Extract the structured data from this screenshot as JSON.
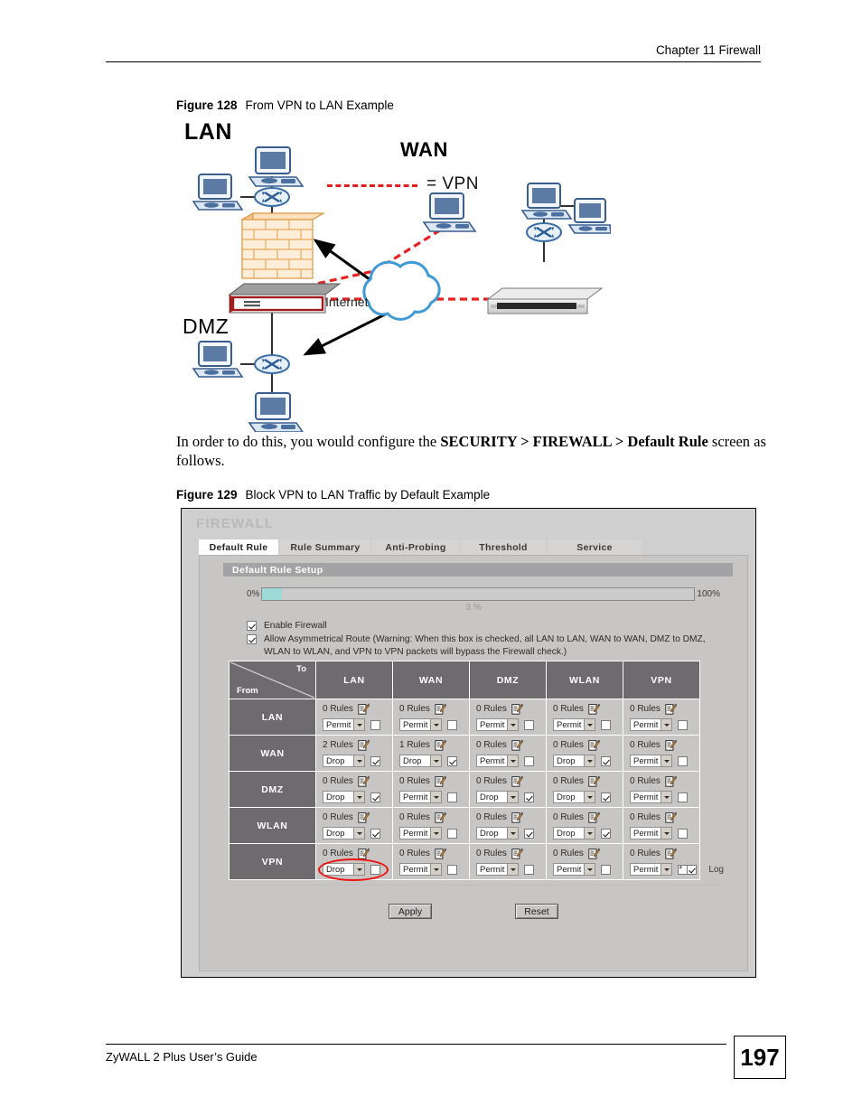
{
  "header": {
    "chapter": "Chapter 11 Firewall"
  },
  "figure128": {
    "number": "Figure 128",
    "title": "From VPN to LAN Example",
    "labels": {
      "lan": "LAN",
      "wan": "WAN",
      "dmz": "DMZ",
      "vpn_legend": "= VPN",
      "internet": "Internet"
    }
  },
  "paragraph": {
    "lead": "In order to do this, you would configure the ",
    "bold": "SECURITY > FIREWALL > Default Rule",
    "tail": " screen as follows."
  },
  "figure129": {
    "number": "Figure 129",
    "title": "Block VPN to LAN Traffic by Default Example"
  },
  "screen": {
    "title": "FIREWALL",
    "tabs": [
      {
        "label": "Default Rule",
        "active": true
      },
      {
        "label": "Rule Summary",
        "active": false
      },
      {
        "label": "Anti-Probing",
        "active": false
      },
      {
        "label": "Threshold",
        "active": false
      },
      {
        "label": "Service",
        "active": false
      }
    ],
    "section_title": "Default Rule Setup",
    "slider": {
      "min_label": "0%",
      "max_label": "100%",
      "value_label": "3 %",
      "percent": 3,
      "fill_color": "#9fd9d6"
    },
    "options": [
      {
        "label": "Enable Firewall",
        "checked": true
      },
      {
        "label": "Allow Asymmetrical Route (Warning: When this box is checked, all LAN to LAN, WAN to WAN, DMZ to DMZ, WLAN to WLAN, and VPN to VPN packets will bypass the Firewall check.)",
        "checked": true
      }
    ],
    "matrix": {
      "corner_to": "To",
      "corner_from": "From",
      "columns": [
        "LAN",
        "WAN",
        "DMZ",
        "WLAN",
        "VPN"
      ],
      "rows": [
        {
          "name": "LAN",
          "cells": [
            {
              "rules": "0  Rules",
              "action": "Permit",
              "log": false
            },
            {
              "rules": "0  Rules",
              "action": "Permit",
              "log": false
            },
            {
              "rules": "0  Rules",
              "action": "Permit",
              "log": false
            },
            {
              "rules": "0  Rules",
              "action": "Permit",
              "log": false
            },
            {
              "rules": "0  Rules",
              "action": "Permit",
              "log": false
            }
          ]
        },
        {
          "name": "WAN",
          "cells": [
            {
              "rules": "2  Rules",
              "action": "Drop",
              "log": true
            },
            {
              "rules": "1  Rules",
              "action": "Drop",
              "log": true
            },
            {
              "rules": "0  Rules",
              "action": "Permit",
              "log": false
            },
            {
              "rules": "0  Rules",
              "action": "Drop",
              "log": true
            },
            {
              "rules": "0  Rules",
              "action": "Permit",
              "log": false
            }
          ]
        },
        {
          "name": "DMZ",
          "cells": [
            {
              "rules": "0  Rules",
              "action": "Drop",
              "log": true
            },
            {
              "rules": "0  Rules",
              "action": "Permit",
              "log": false
            },
            {
              "rules": "0  Rules",
              "action": "Drop",
              "log": true
            },
            {
              "rules": "0  Rules",
              "action": "Drop",
              "log": true
            },
            {
              "rules": "0  Rules",
              "action": "Permit",
              "log": false
            }
          ]
        },
        {
          "name": "WLAN",
          "cells": [
            {
              "rules": "0  Rules",
              "action": "Drop",
              "log": true
            },
            {
              "rules": "0  Rules",
              "action": "Permit",
              "log": false
            },
            {
              "rules": "0  Rules",
              "action": "Drop",
              "log": true
            },
            {
              "rules": "0  Rules",
              "action": "Drop",
              "log": true
            },
            {
              "rules": "0  Rules",
              "action": "Permit",
              "log": false
            }
          ]
        },
        {
          "name": "VPN",
          "cells": [
            {
              "rules": "0  Rules",
              "action": "Drop",
              "log": false,
              "highlighted": true
            },
            {
              "rules": "0  Rules",
              "action": "Permit",
              "log": false
            },
            {
              "rules": "0  Rules",
              "action": "Permit",
              "log": false
            },
            {
              "rules": "0  Rules",
              "action": "Permit",
              "log": false
            },
            {
              "rules": "0  Rules",
              "action": "Permit",
              "log": false
            }
          ]
        }
      ]
    },
    "log_row": {
      "star": "*",
      "label": "Log",
      "checked": true
    },
    "buttons": {
      "apply": "Apply",
      "reset": "Reset"
    },
    "highlight_color": "#ee1111"
  },
  "footer": {
    "guide": "ZyWALL 2 Plus User’s Guide",
    "page": "197"
  }
}
